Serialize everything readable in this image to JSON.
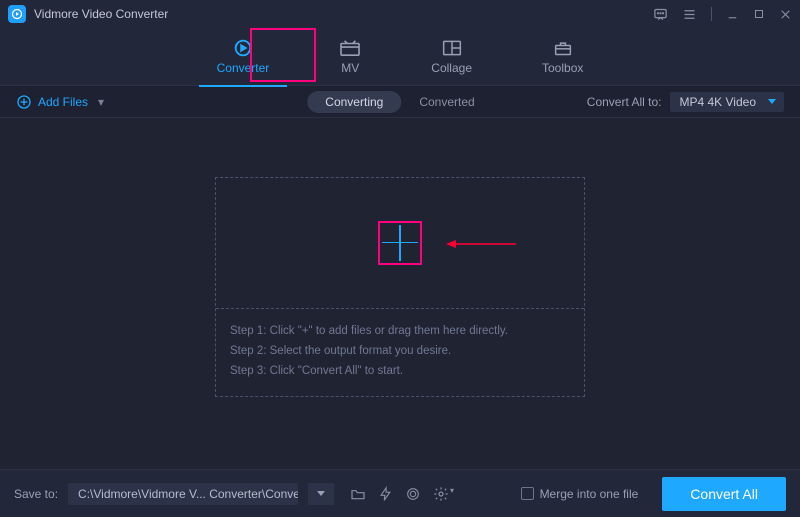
{
  "titlebar": {
    "title": "Vidmore Video Converter"
  },
  "maintabs": {
    "converter": "Converter",
    "mv": "MV",
    "collage": "Collage",
    "toolbox": "Toolbox"
  },
  "toolbar": {
    "add_files": "Add Files",
    "subtabs": {
      "converting": "Converting",
      "converted": "Converted"
    },
    "convert_all_to_label": "Convert All to:",
    "format_selected": "MP4 4K Video"
  },
  "dropzone": {
    "step1": "Step 1: Click \"+\" to add files or drag them here directly.",
    "step2": "Step 2: Select the output format you desire.",
    "step3": "Step 3: Click \"Convert All\" to start."
  },
  "footer": {
    "save_to_label": "Save to:",
    "path": "C:\\Vidmore\\Vidmore V... Converter\\Converted",
    "merge_label": "Merge into one file",
    "convert_button": "Convert All"
  }
}
